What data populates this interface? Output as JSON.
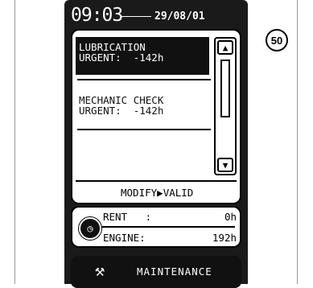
{
  "header": {
    "time": "09:03",
    "date": "29/08/01"
  },
  "alerts": [
    {
      "line1": "LUBRICATION",
      "line2": "URGENT:  -142h"
    },
    {
      "line1": "MECHANIC CHECK",
      "line2": "URGENT:  -142h"
    }
  ],
  "scrollbar": {
    "up_icon": "▲",
    "down_icon": "▼"
  },
  "footer": {
    "modify_label": "MODIFY",
    "arrow": "▶",
    "valid_label": "VALID"
  },
  "counters": {
    "rent_label": "RENT   :",
    "rent_value": "0h",
    "engine_label": "ENGINE:",
    "engine_value": "192h"
  },
  "maintenance": {
    "label": "MAINTENANCE",
    "icon": "hammer-icon"
  },
  "figure_badge": "50"
}
